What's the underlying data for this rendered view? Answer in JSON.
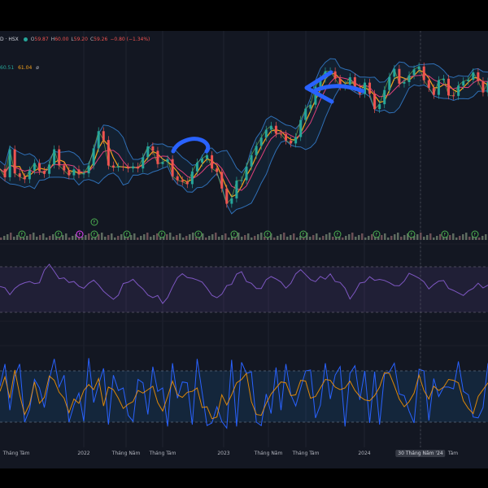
{
  "header": {
    "symbol": "D · HSX",
    "open_label": "O",
    "open": "59.87",
    "high_label": "H",
    "high": "60.00",
    "low_label": "L",
    "low": "59.20",
    "close_label": "C",
    "close": "59.26",
    "change": "−0.80 (−1.34%)"
  },
  "ma_values": {
    "v1": "60.51",
    "v2": "61.04",
    "v3": "ø"
  },
  "x_axis": {
    "ticks": [
      "Tháng Tám",
      "2022",
      "Tháng Năm",
      "Tháng Tám",
      "2023",
      "Tháng Năm",
      "Tháng Tám",
      "2024",
      "30 Tháng Năm '24",
      "Tám"
    ]
  },
  "colors": {
    "background": "#131722",
    "up": "#26a69a",
    "down": "#ef5350",
    "bollinger": "#2962ff",
    "ma_fast": "#f7a21b",
    "rsi": "#7e57c2",
    "stoch_k": "#2962ff",
    "stoch_d": "#ff9800",
    "annotation": "#2962ff"
  },
  "chart_data": [
    {
      "type": "line",
      "panel": "price",
      "series": [
        {
          "values": [
            49.5,
            47.8,
            53.5,
            48.6,
            47.9,
            47.4,
            49.2,
            50.7,
            49.1,
            48.5,
            50.4,
            53.5,
            50.2,
            49.2,
            48.2,
            49.4,
            48.4,
            48.6,
            50.2,
            53.7,
            57.2,
            55.4,
            50.2,
            49.8,
            50.0,
            49.9,
            49.6,
            50.0,
            49.6,
            51.9,
            54.1,
            53.2,
            50.5,
            50.9,
            51.5,
            48.0,
            47.2,
            46.9,
            46.4,
            49.0,
            50.8,
            51.6,
            52.3,
            49.6,
            48.9,
            45.5,
            42.4,
            43.5,
            47.1,
            47.2,
            50.0,
            52.3,
            54.2,
            55.9,
            57.5,
            58.3,
            56.7,
            56.6,
            55.3,
            54.7,
            56.0,
            59.5,
            61.8,
            62.6,
            66.3,
            67.9,
            69.4,
            69.4,
            67.9,
            66.3,
            66.7,
            68.2,
            66.1,
            64.8,
            67.1,
            64.8,
            61.7,
            62.7,
            65.6,
            68.3,
            69.9,
            66.9,
            67.2,
            68.6,
            69.8,
            70.4,
            67.6,
            66.0,
            64.6,
            67.6,
            67.9,
            64.5,
            64.4,
            66.5,
            67.4,
            67.7,
            69.2,
            67.4,
            65.1,
            67.3
          ]
        }
      ],
      "bollinger": true
    },
    {
      "type": "bar",
      "panel": "volume",
      "dividend_marker_label": "F"
    },
    {
      "type": "line",
      "panel": "rsi",
      "band": [
        30,
        70
      ],
      "ylim": [
        10,
        90
      ],
      "series": [
        {
          "values": [
            52.7,
            51.5,
            45.5,
            51.0,
            54.2,
            56.0,
            57.1,
            55.2,
            55.9,
            67.1,
            72.2,
            66.0,
            59.5,
            60.3,
            56.2,
            57.1,
            52.9,
            51.1,
            55.5,
            58.3,
            54.0,
            48.5,
            44.8,
            41.4,
            45.1,
            55.3,
            56.4,
            59.0,
            54.2,
            50.5,
            45.2,
            42.9,
            44.8,
            37.8,
            43.0,
            52.3,
            60.4,
            63.9,
            60.5,
            59.9,
            58.4,
            56.6,
            51.2,
            44.9,
            42.8,
            45.9,
            53.4,
            54.6,
            63.6,
            65.7,
            57.1,
            55.5,
            50.9,
            50.9,
            58.7,
            61.4,
            59.3,
            56.6,
            51.2,
            55.5,
            63.8,
            67.5,
            63.1,
            58.7,
            56.9,
            61.5,
            59.1,
            63.8,
            57.1,
            56.2,
            51.2,
            41.7,
            47.9,
            55.7,
            56.5,
            61.3,
            58.1,
            58.9,
            58.0,
            56.0,
            53.5,
            53.3,
            57.4,
            64.3,
            62.3,
            60.0,
            56.8,
            50.5,
            54.4,
            57.4,
            57.9,
            51.0,
            49.2,
            47.0,
            44.8,
            48.8,
            51.0,
            55.6,
            51.4,
            53.9
          ]
        }
      ]
    },
    {
      "type": "line",
      "panel": "stochastic",
      "band": [
        20,
        80
      ],
      "ylim": [
        0,
        100
      ],
      "series": [
        {
          "values": [
            62,
            88,
            34,
            74,
            88,
            20,
            35,
            70,
            60,
            37,
            70,
            94,
            61,
            75,
            20,
            40,
            54,
            21,
            95,
            43,
            64,
            83,
            17,
            75,
            57,
            60,
            28,
            21,
            70,
            66,
            29,
            85,
            56,
            60,
            15,
            89,
            48,
            67,
            66,
            17,
            94,
            55,
            16,
            19,
            38,
            21,
            13,
            93,
            15,
            90,
            77,
            79,
            20,
            16,
            53,
            30,
            84,
            34,
            88,
            52,
            39,
            60,
            80,
            81,
            25,
            40,
            89,
            47,
            75,
            85,
            15,
            77,
            86,
            46,
            80,
            19,
            79,
            17,
            76,
            79,
            89,
            53,
            51,
            33,
            19,
            82,
            80,
            22,
            71,
            50,
            61,
            61,
            59,
            91,
            56,
            52,
            26,
            25,
            37,
            89
          ]
        },
        {
          "values": [
            56,
            73,
            48,
            81,
            52,
            29,
            41,
            67,
            42,
            49,
            74,
            69,
            55,
            48,
            31,
            47,
            42,
            57,
            64,
            58,
            71,
            39,
            61,
            58,
            48,
            36,
            41,
            44,
            57,
            54,
            58,
            62,
            43,
            33,
            50,
            68,
            52,
            49,
            55,
            56,
            60,
            37,
            38,
            24,
            26,
            52,
            40,
            52,
            66,
            70,
            77,
            44,
            29,
            28,
            42,
            53,
            60,
            67,
            66,
            51,
            52,
            69,
            68,
            48,
            50,
            60,
            70,
            69,
            61,
            58,
            60,
            68,
            57,
            50,
            46,
            45,
            51,
            61,
            78,
            77,
            63,
            47,
            38,
            44,
            54,
            75,
            57,
            47,
            62,
            57,
            61,
            70,
            69,
            66,
            45,
            36,
            30,
            50,
            58,
            66
          ]
        }
      ]
    }
  ]
}
